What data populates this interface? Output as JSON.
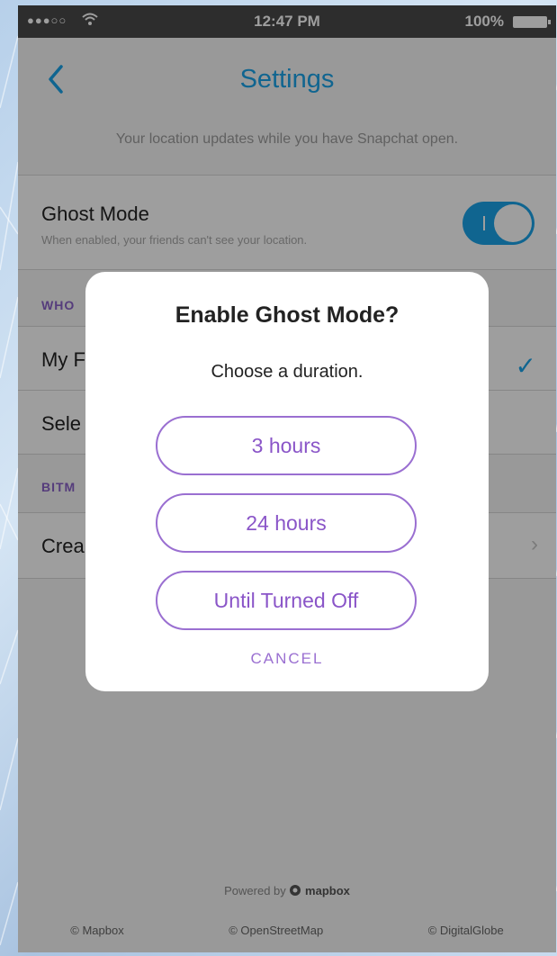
{
  "status_bar": {
    "carrier": "●●●○○",
    "time": "12:47 PM",
    "battery": "100%"
  },
  "nav": {
    "title": "Settings"
  },
  "info_text": "Your location updates while you have Snapchat open.",
  "ghost_mode": {
    "title": "Ghost Mode",
    "subtitle": "When enabled, your friends can't see your location.",
    "enabled": true
  },
  "sections": {
    "who": {
      "label": "WHO",
      "rows": [
        {
          "label": "My F",
          "checked": true
        },
        {
          "label": "Sele"
        }
      ]
    },
    "bitmoji": {
      "label": "BITM",
      "rows": [
        {
          "label": "Crea"
        }
      ]
    }
  },
  "footer": {
    "powered_prefix": "Powered by",
    "powered_brand": "mapbox",
    "credits": [
      "© Mapbox",
      "© OpenStreetMap",
      "© DigitalGlobe"
    ]
  },
  "dialog": {
    "title": "Enable Ghost Mode?",
    "subtitle": "Choose a duration.",
    "options": [
      "3 hours",
      "24 hours",
      "Until Turned Off"
    ],
    "cancel": "CANCEL"
  },
  "colors": {
    "accent_blue": "#1aa3e8",
    "accent_purple": "#9a6fd1"
  }
}
